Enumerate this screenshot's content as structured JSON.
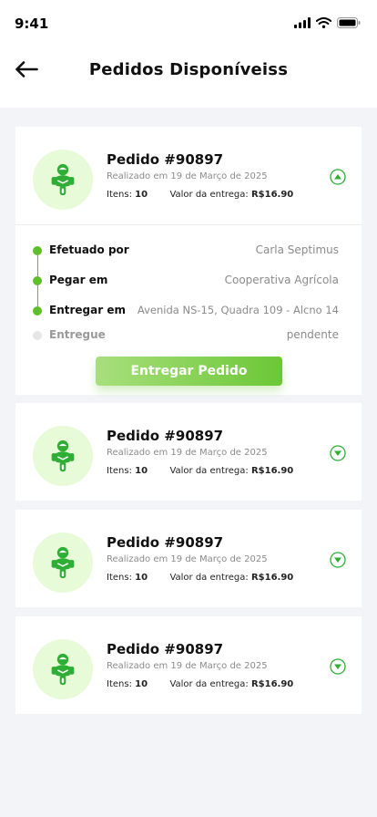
{
  "status_bar": {
    "time": "9:41"
  },
  "header": {
    "title": "Pedidos Disponíveiss"
  },
  "colors": {
    "accent": "#5fbf2a",
    "avatar_bg": "#e7fbd8",
    "rider": "#2fae35"
  },
  "orders": [
    {
      "title": "Pedido #90897",
      "date": "Realizado em 19 de Março de 2025",
      "items_label": "Itens:",
      "items_value": "10",
      "value_label": "Valor da entrega:",
      "value": "R$16.90",
      "expanded": true,
      "timeline": [
        {
          "label": "Efetuado por",
          "value": "Carla Septimus",
          "done": true
        },
        {
          "label": "Pegar em",
          "value": "Cooperativa Agrícola",
          "done": true
        },
        {
          "label": "Entregar em",
          "value": "Avenida NS-15, Quadra 109 - Alcno 14",
          "done": true
        },
        {
          "label": "Entregue",
          "value": "pendente",
          "done": false
        }
      ],
      "action_label": "Entregar Pedido"
    },
    {
      "title": "Pedido #90897",
      "date": "Realizado em 19 de Março de 2025",
      "items_label": "Itens:",
      "items_value": "10",
      "value_label": "Valor da entrega:",
      "value": "R$16.90",
      "expanded": false
    },
    {
      "title": "Pedido #90897",
      "date": "Realizado em 19 de Março de 2025",
      "items_label": "Itens:",
      "items_value": "10",
      "value_label": "Valor da entrega:",
      "value": "R$16.90",
      "expanded": false
    },
    {
      "title": "Pedido #90897",
      "date": "Realizado em 19 de Março de 2025",
      "items_label": "Itens:",
      "items_value": "10",
      "value_label": "Valor da entrega:",
      "value": "R$16.90",
      "expanded": false
    }
  ]
}
